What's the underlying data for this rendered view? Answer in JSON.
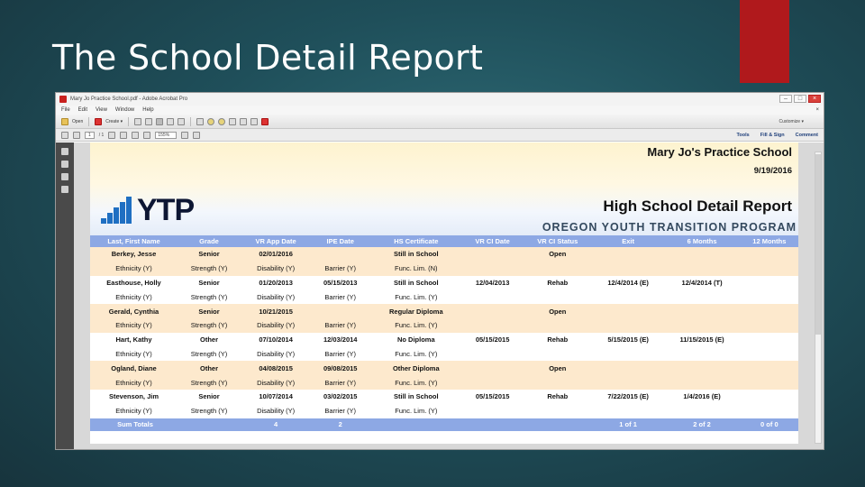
{
  "slide": {
    "title": "The School Detail Report"
  },
  "window": {
    "title": "Mary Jo Practice School.pdf - Adobe Acrobat Pro",
    "controls": [
      "–",
      "□",
      "×"
    ],
    "close_x": "×"
  },
  "menu": [
    "File",
    "Edit",
    "View",
    "Window",
    "Help"
  ],
  "toolbar": {
    "open": "Open",
    "create": "Create ▾",
    "customize": "Customize ▾"
  },
  "nav": {
    "page_current": "1",
    "page_total": "/ 1",
    "zoom": "155%"
  },
  "tabs": [
    "Tools",
    "Fill & Sign",
    "Comment"
  ],
  "report": {
    "school": "Mary Jo's Practice School",
    "date": "9/19/2016",
    "title": "High School Detail Report",
    "program": "OREGON YOUTH TRANSITION PROGRAM",
    "logo_text": "YTP",
    "columns": [
      "Last, First Name",
      "Grade",
      "VR App Date",
      "IPE Date",
      "HS Certificate",
      "VR CI Date",
      "VR CI Status",
      "Exit",
      "6 Months",
      "12 Months"
    ],
    "students": [
      {
        "main": [
          "Berkey, Jesse",
          "Senior",
          "02/01/2016",
          "",
          "Still in School",
          "",
          "Open",
          "",
          "",
          ""
        ],
        "sub": [
          "Ethnicity (Y)",
          "Strength (Y)",
          "Disability (Y)",
          "Barrier (Y)",
          "Func. Lim. (N)",
          "",
          "",
          "",
          "",
          ""
        ]
      },
      {
        "main": [
          "Easthouse, Holly",
          "Senior",
          "01/20/2013",
          "05/15/2013",
          "Still in School",
          "12/04/2013",
          "Rehab",
          "12/4/2014 (E)",
          "12/4/2014 (T)",
          ""
        ],
        "sub": [
          "Ethnicity (Y)",
          "Strength (Y)",
          "Disability (Y)",
          "Barrier (Y)",
          "Func. Lim. (Y)",
          "",
          "",
          "",
          "",
          ""
        ]
      },
      {
        "main": [
          "Gerald, Cynthia",
          "Senior",
          "10/21/2015",
          "",
          "Regular Diploma",
          "",
          "Open",
          "",
          "",
          ""
        ],
        "sub": [
          "Ethnicity (Y)",
          "Strength (Y)",
          "Disability (Y)",
          "Barrier (Y)",
          "Func. Lim. (Y)",
          "",
          "",
          "",
          "",
          ""
        ]
      },
      {
        "main": [
          "Hart, Kathy",
          "Other",
          "07/10/2014",
          "12/03/2014",
          "No Diploma",
          "05/15/2015",
          "Rehab",
          "5/15/2015 (E)",
          "11/15/2015 (E)",
          ""
        ],
        "sub": [
          "Ethnicity (Y)",
          "Strength (Y)",
          "Disability (Y)",
          "Barrier (Y)",
          "Func. Lim. (Y)",
          "",
          "",
          "",
          "",
          ""
        ]
      },
      {
        "main": [
          "Ogland, Diane",
          "Other",
          "04/08/2015",
          "09/08/2015",
          "Other Diploma",
          "",
          "Open",
          "",
          "",
          ""
        ],
        "sub": [
          "Ethnicity (Y)",
          "Strength (Y)",
          "Disability (Y)",
          "Barrier (Y)",
          "Func. Lim. (Y)",
          "",
          "",
          "",
          "",
          ""
        ]
      },
      {
        "main": [
          "Stevenson, Jim",
          "Senior",
          "10/07/2014",
          "03/02/2015",
          "Still in School",
          "05/15/2015",
          "Rehab",
          "7/22/2015 (E)",
          "1/4/2016 (E)",
          ""
        ],
        "sub": [
          "Ethnicity (Y)",
          "Strength (Y)",
          "Disability (Y)",
          "Barrier (Y)",
          "Func. Lim. (Y)",
          "",
          "",
          "",
          "",
          ""
        ]
      }
    ],
    "totals": [
      "Sum Totals",
      "",
      "4",
      "2",
      "",
      "",
      "",
      "1 of 1",
      "2 of 2",
      "0 of 0"
    ]
  },
  "colors": {
    "header_blue": "#8da8e4",
    "row_peach": "#fde9cd",
    "accent_red": "#b0191c",
    "logo_blue": "#1f6fc2"
  }
}
